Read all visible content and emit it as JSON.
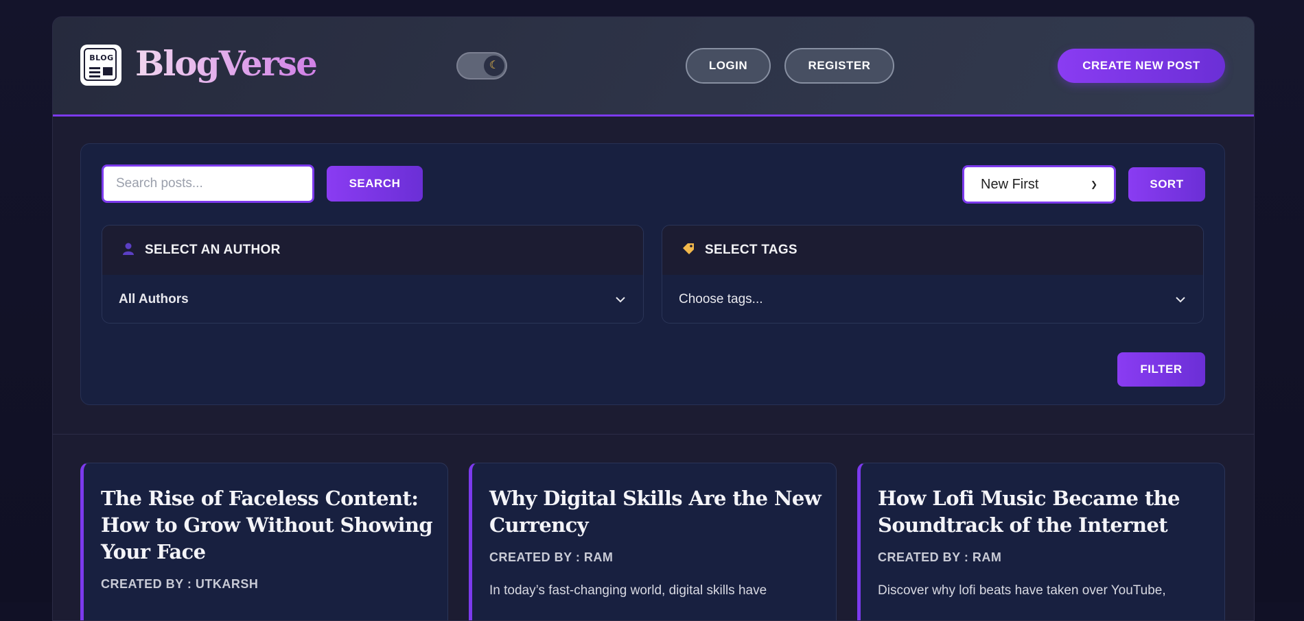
{
  "header": {
    "logo_text": "BLOG",
    "brand": "BlogVerse",
    "theme_toggle_icon": "moon-icon",
    "login_label": "LOGIN",
    "register_label": "REGISTER",
    "create_post_label": "CREATE NEW POST"
  },
  "filters": {
    "search_placeholder": "Search posts...",
    "search_value": "",
    "search_button": "SEARCH",
    "sort_selected": "New First",
    "sort_button": "SORT",
    "author_heading": "SELECT AN AUTHOR",
    "author_value": "All Authors",
    "tags_heading": "SELECT TAGS",
    "tags_placeholder": "Choose tags...",
    "filter_button": "FILTER"
  },
  "posts": [
    {
      "title": "The Rise of Faceless Content: How to Grow Without Showing Your Face",
      "author": "CREATED BY : UTKARSH",
      "excerpt": ""
    },
    {
      "title": "Why Digital Skills Are the New Currency",
      "author": "CREATED BY : RAM",
      "excerpt": "In today’s fast-changing world, digital skills have"
    },
    {
      "title": "How Lofi Music Became the Soundtrack of the Internet",
      "author": "CREATED BY : RAM",
      "excerpt": "Discover why lofi beats have taken over YouTube,"
    }
  ],
  "colors": {
    "accent": "#7c3aed",
    "page_bg": "#111126",
    "panel_bg": "#182040",
    "header_bg": "#2e3448"
  }
}
